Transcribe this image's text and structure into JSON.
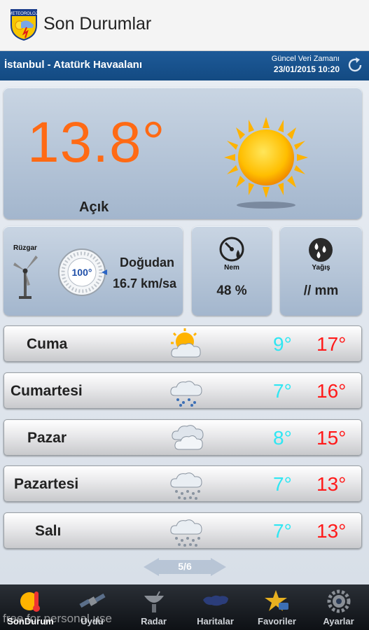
{
  "app": {
    "title": "Son Durumlar",
    "logo_text": "METEOROLOJİ"
  },
  "location": {
    "name": "İstanbul - Atatürk Havaalanı",
    "update_label": "Güncel Veri Zamanı",
    "update_time": "23/01/2015 10:20"
  },
  "current": {
    "temperature": "13.8°",
    "condition": "Açık",
    "wind": {
      "label": "Rüzgar",
      "direction_deg": "100°",
      "direction": "Doğudan",
      "speed": "16.7 km/sa"
    },
    "humidity": {
      "label": "Nem",
      "value": "48 %"
    },
    "precipitation": {
      "label": "Yağış",
      "value": "// mm"
    }
  },
  "forecast": [
    {
      "day": "Cuma",
      "icon": "partly-cloudy-icon",
      "low": "9°",
      "high": "17°"
    },
    {
      "day": "Cumartesi",
      "icon": "rain-cloud-icon",
      "low": "7°",
      "high": "16°"
    },
    {
      "day": "Pazar",
      "icon": "cloudy-icon",
      "low": "8°",
      "high": "15°"
    },
    {
      "day": "Pazartesi",
      "icon": "snow-cloud-icon",
      "low": "7°",
      "high": "13°"
    },
    {
      "day": "Salı",
      "icon": "snow-cloud-icon",
      "low": "7°",
      "high": "13°"
    }
  ],
  "pager": {
    "text": "5/6"
  },
  "tabs": [
    {
      "label": "SonDurum",
      "icon": "sun-thermometer-icon"
    },
    {
      "label": "Uydu",
      "icon": "satellite-icon"
    },
    {
      "label": "Radar",
      "icon": "radar-dish-icon"
    },
    {
      "label": "Haritalar",
      "icon": "map-icon"
    },
    {
      "label": "Favoriler",
      "icon": "star-icon"
    },
    {
      "label": "Ayarlar",
      "icon": "gear-icon"
    }
  ],
  "watermark": "free for personal use",
  "colors": {
    "temp": "#ff6a14",
    "low": "#2fe6f2",
    "high": "#ff1a1a",
    "header": "#1d5a98"
  }
}
